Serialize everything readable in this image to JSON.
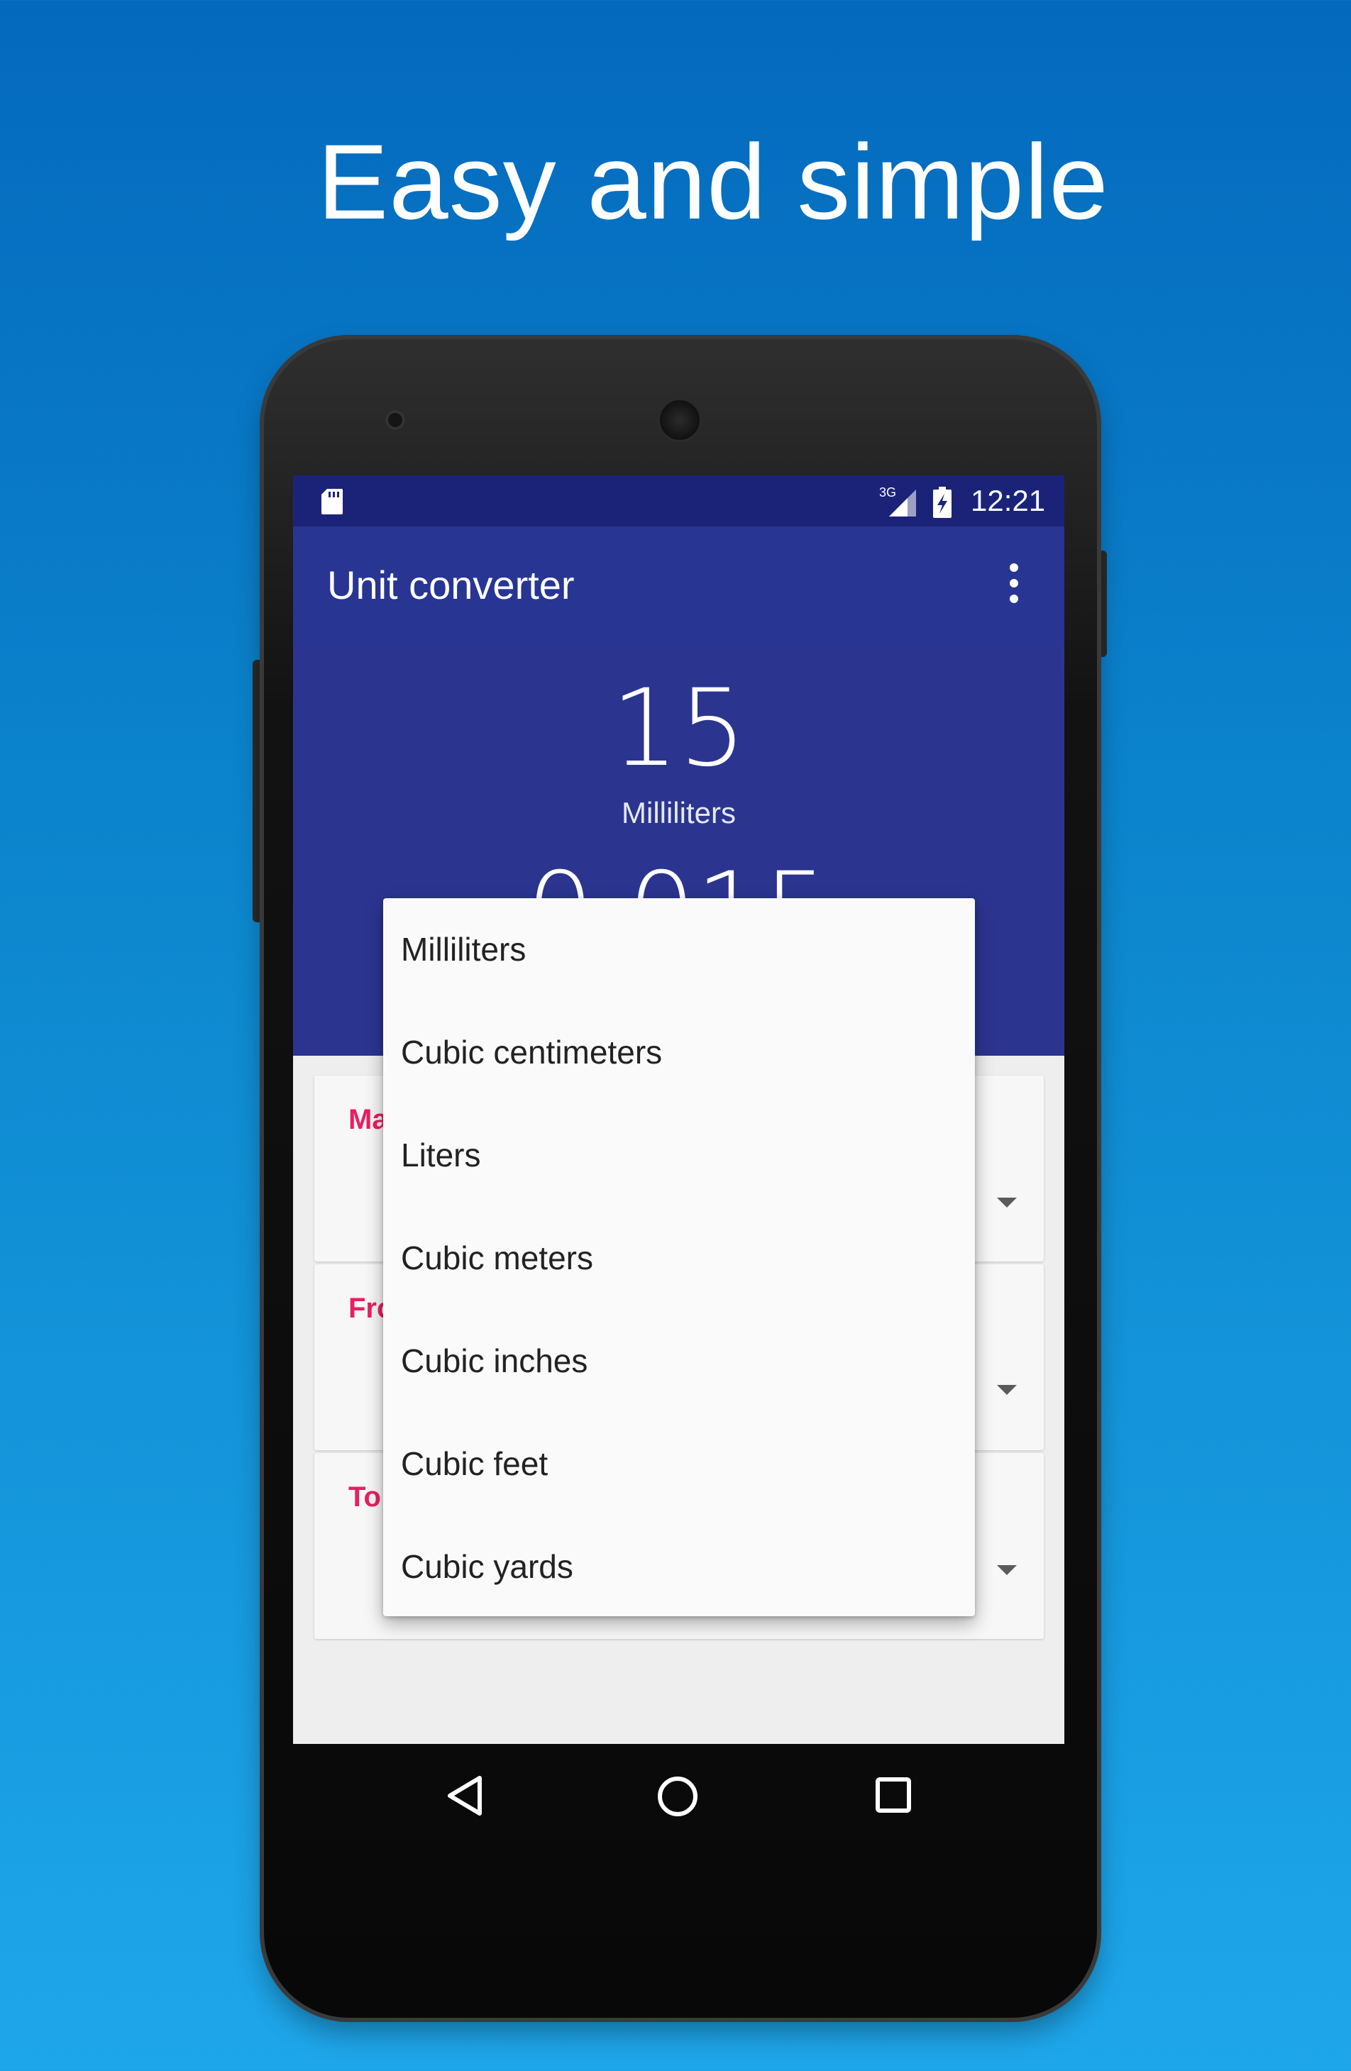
{
  "headline": "Easy and simple",
  "status_bar": {
    "time": "12:21",
    "network_label": "3G",
    "icons": [
      "sd-card-icon",
      "signal-icon",
      "battery-icon"
    ]
  },
  "app_bar": {
    "title": "Unit converter",
    "menu_icon": "overflow-menu-icon"
  },
  "conversion": {
    "input_value": "15",
    "input_unit": "Milliliters",
    "result_value": "0.015"
  },
  "cards": [
    {
      "label": "Ma"
    },
    {
      "label": "Fro"
    },
    {
      "label": "To"
    }
  ],
  "dropdown": {
    "options": [
      "Milliliters",
      "Cubic centimeters",
      "Liters",
      "Cubic meters",
      "Cubic inches",
      "Cubic feet",
      "Cubic yards"
    ]
  },
  "navigation": {
    "back_icon": "back-icon",
    "home_icon": "home-icon",
    "recents_icon": "recents-icon"
  },
  "colors": {
    "primary": "#283593",
    "status_bar": "#1b2379",
    "accent": "#e91e63",
    "background_top": "#0469bd",
    "background_bottom": "#1ea6ea"
  }
}
